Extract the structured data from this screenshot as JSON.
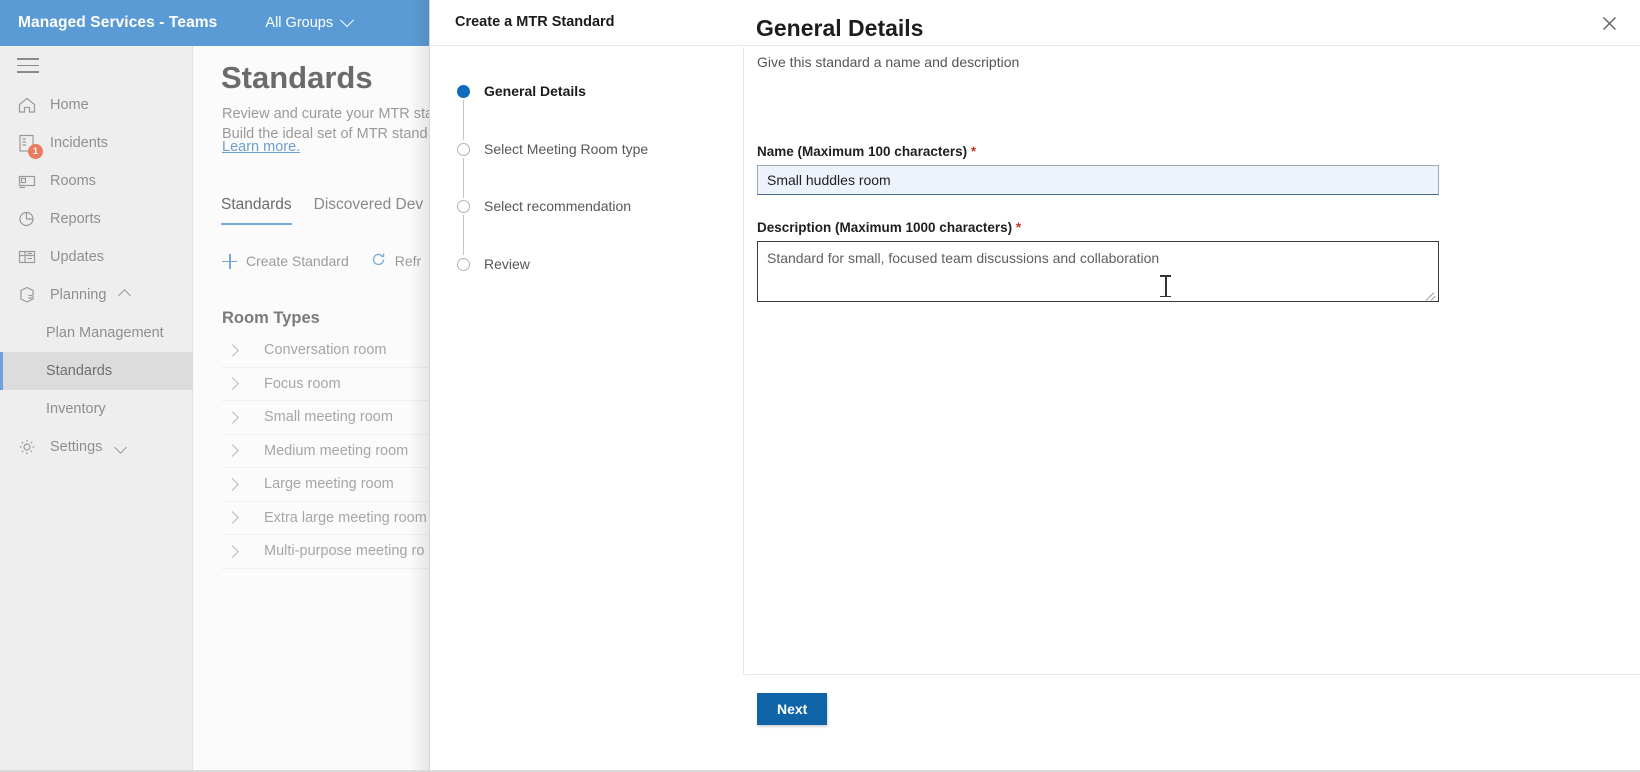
{
  "app": {
    "topbar": {
      "title": "Managed Services - Teams",
      "group_filter": "All Groups",
      "chevron_icon": "chevron-down-icon",
      "background": "#5b9bd5"
    },
    "sidebar": {
      "menu_icon": "hamburger-icon",
      "items": [
        {
          "label": "Home",
          "icon": "home-icon"
        },
        {
          "label": "Incidents",
          "icon": "incidents-icon",
          "badge": "1"
        },
        {
          "label": "Rooms",
          "icon": "rooms-icon"
        },
        {
          "label": "Reports",
          "icon": "reports-icon"
        },
        {
          "label": "Updates",
          "icon": "updates-icon"
        },
        {
          "label": "Planning",
          "icon": "planning-icon",
          "chevron": "chevron-up-icon"
        },
        {
          "label": "Plan Management",
          "icon": "",
          "sub": true
        },
        {
          "label": "Standards",
          "icon": "",
          "sub": true,
          "active": true
        },
        {
          "label": "Inventory",
          "icon": "",
          "sub": true
        },
        {
          "label": "Settings",
          "icon": "gear-icon",
          "chevron": "chevron-down-icon"
        }
      ]
    },
    "page": {
      "title": "Standards",
      "subtitle_line1": "Review and curate your MTR sta",
      "subtitle_line2": "Build the ideal set of MTR stand",
      "learn_more": "Learn more.",
      "tabs": [
        {
          "label": "Standards",
          "active": true
        },
        {
          "label": "Discovered Dev",
          "active": false
        }
      ],
      "toolbar": [
        {
          "label": "Create Standard",
          "icon": "plus-icon"
        },
        {
          "label": "Refr",
          "icon": "refresh-icon"
        }
      ],
      "section_heading": "Room Types",
      "room_types": [
        "Conversation room",
        "Focus room",
        "Small meeting room",
        "Medium meeting room",
        "Large meeting room",
        "Extra large meeting room",
        "Multi-purpose meeting ro"
      ]
    }
  },
  "dialog": {
    "title": "Create a MTR Standard",
    "close_icon": "close-icon",
    "steps": [
      {
        "label": "General Details",
        "state": "current"
      },
      {
        "label": "Select Meeting Room type",
        "state": "pending"
      },
      {
        "label": "Select recommendation",
        "state": "pending"
      },
      {
        "label": "Review",
        "state": "pending"
      }
    ],
    "content": {
      "heading": "General Details",
      "subheading": "Give this standard a name and description",
      "name_label": "Name (Maximum 100 characters)",
      "name_required_marker": "*",
      "name_value": "Small huddles room",
      "name_placeholder": "",
      "description_label": "Description (Maximum 1000 characters)",
      "description_required_marker": "*",
      "description_value": "Standard for small, focused team discussions and collaboration",
      "description_placeholder": ""
    },
    "footer": {
      "next_label": "Next",
      "next_color": "#0f64a8"
    }
  }
}
